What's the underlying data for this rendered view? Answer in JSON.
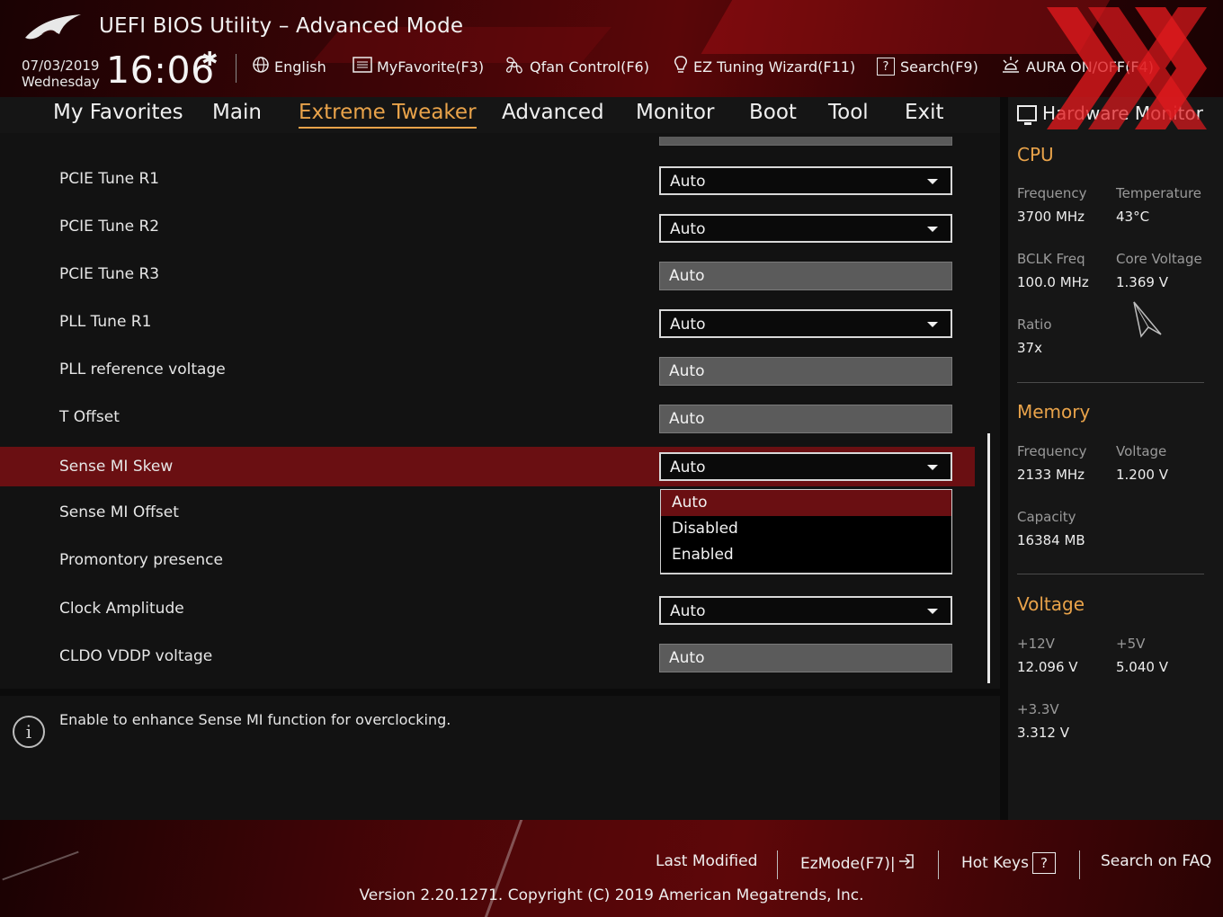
{
  "header": {
    "title": "UEFI BIOS Utility – Advanced Mode",
    "date": "07/03/2019",
    "weekday": "Wednesday",
    "time": "16:06",
    "toolbar": [
      {
        "id": "language",
        "label": "English",
        "icon": "globe-icon"
      },
      {
        "id": "myfavorite",
        "label": "MyFavorite(F3)",
        "icon": "list-icon"
      },
      {
        "id": "qfan",
        "label": "Qfan Control(F6)",
        "icon": "fan-icon"
      },
      {
        "id": "ez-tuning",
        "label": "EZ Tuning Wizard(F11)",
        "icon": "lightbulb-icon"
      },
      {
        "id": "search",
        "label": "Search(F9)",
        "icon": "help-box-icon"
      },
      {
        "id": "aura",
        "label": "AURA ON/OFF(F4)",
        "icon": "aura-icon"
      }
    ]
  },
  "tabs": [
    {
      "label": "My Favorites",
      "active": false
    },
    {
      "label": "Main",
      "active": false
    },
    {
      "label": "Extreme Tweaker",
      "active": true
    },
    {
      "label": "Advanced",
      "active": false
    },
    {
      "label": "Monitor",
      "active": false
    },
    {
      "label": "Boot",
      "active": false
    },
    {
      "label": "Tool",
      "active": false
    },
    {
      "label": "Exit",
      "active": false
    }
  ],
  "settings": [
    {
      "label": "PCIE Tune R1",
      "value": "Auto",
      "type": "dropdown"
    },
    {
      "label": "PCIE Tune R2",
      "value": "Auto",
      "type": "dropdown"
    },
    {
      "label": "PCIE Tune R3",
      "value": "Auto",
      "type": "readonly"
    },
    {
      "label": "PLL Tune R1",
      "value": "Auto",
      "type": "dropdown"
    },
    {
      "label": "PLL reference voltage",
      "value": "Auto",
      "type": "readonly"
    },
    {
      "label": "T Offset",
      "value": "Auto",
      "type": "readonly"
    },
    {
      "label": "Sense MI Skew",
      "value": "Auto",
      "type": "dropdown",
      "selected": true
    },
    {
      "label": "Sense MI Offset",
      "value": "",
      "type": "hidden"
    },
    {
      "label": "Promontory presence",
      "value": "",
      "type": "hidden"
    },
    {
      "label": "Clock Amplitude",
      "value": "Auto",
      "type": "dropdown"
    },
    {
      "label": "CLDO VDDP voltage",
      "value": "Auto",
      "type": "readonly"
    }
  ],
  "dropdown_open": {
    "options": [
      "Auto",
      "Disabled",
      "Enabled"
    ],
    "highlighted": "Auto"
  },
  "help": {
    "text": "Enable to enhance Sense MI function for overclocking."
  },
  "hardware_monitor": {
    "title": "Hardware Monitor",
    "cpu": {
      "heading": "CPU",
      "frequency_label": "Frequency",
      "frequency": "3700 MHz",
      "temperature_label": "Temperature",
      "temperature": "43°C",
      "bclk_label": "BCLK Freq",
      "bclk": "100.0 MHz",
      "core_voltage_label": "Core Voltage",
      "core_voltage": "1.369 V",
      "ratio_label": "Ratio",
      "ratio": "37x"
    },
    "memory": {
      "heading": "Memory",
      "frequency_label": "Frequency",
      "frequency": "2133 MHz",
      "voltage_label": "Voltage",
      "voltage": "1.200 V",
      "capacity_label": "Capacity",
      "capacity": "16384 MB"
    },
    "voltage": {
      "heading": "Voltage",
      "v12_label": "+12V",
      "v12": "12.096 V",
      "v5_label": "+5V",
      "v5": "5.040 V",
      "v33_label": "+3.3V",
      "v33": "3.312 V"
    }
  },
  "footer": {
    "last_modified": "Last Modified",
    "ezmode": "EzMode(F7)|",
    "hot_keys": "Hot Keys",
    "search_faq": "Search on FAQ",
    "version": "Version 2.20.1271. Copyright (C) 2019 American Megatrends, Inc."
  },
  "colors": {
    "accent": "#e9a34a",
    "selection": "#6a0f12",
    "header_red": "#5a0608"
  }
}
